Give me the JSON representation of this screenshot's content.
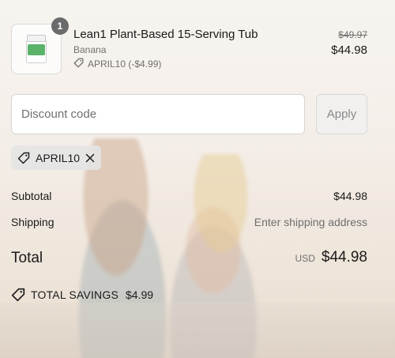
{
  "cart": {
    "item": {
      "quantity": "1",
      "name": "Lean1 Plant-Based 15-Serving Tub",
      "variant": "Banana",
      "discount_text": "APRIL10 (-$4.99)",
      "original_price": "$49.97",
      "price": "$44.98"
    }
  },
  "discount": {
    "placeholder": "Discount code",
    "value": "",
    "apply_label": "Apply",
    "applied_code": "APRIL10"
  },
  "summary": {
    "subtotal_label": "Subtotal",
    "subtotal_value": "$44.98",
    "shipping_label": "Shipping",
    "shipping_value": "Enter shipping address",
    "total_label": "Total",
    "currency": "USD",
    "total_value": "$44.98",
    "savings_label": "TOTAL SAVINGS",
    "savings_value": "$4.99"
  },
  "icons": {
    "tag": "tag-icon",
    "close": "close-icon"
  }
}
